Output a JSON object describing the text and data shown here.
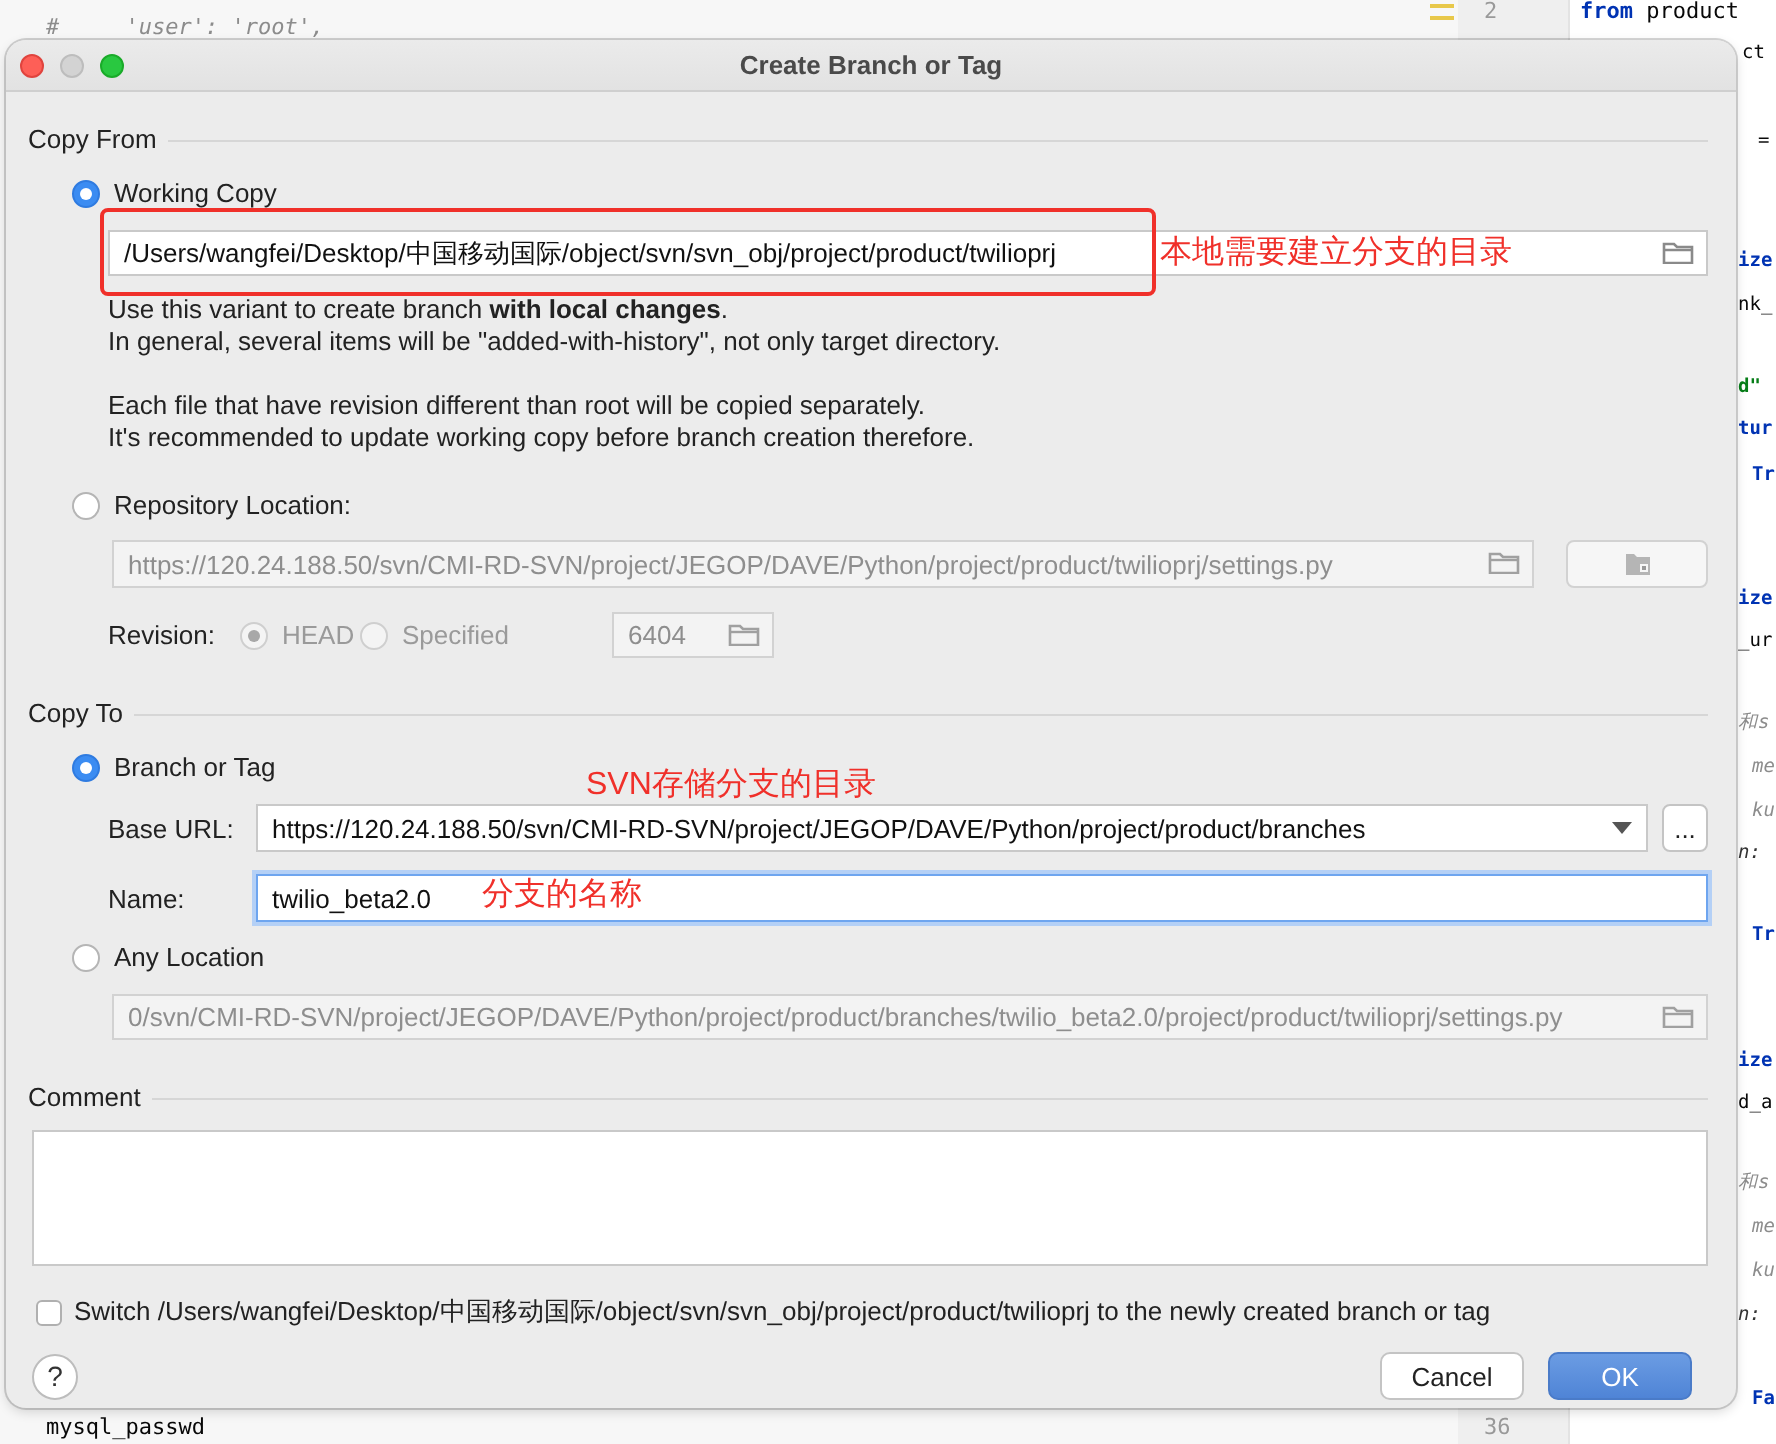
{
  "editor": {
    "left_lines": [
      {
        "text": "#     'user': 'root',",
        "kind": "comment"
      },
      {
        "text": "mysql_passwd",
        "kind": "plain"
      }
    ],
    "line_numbers": [
      "2",
      "36"
    ],
    "right_lines": [
      [
        {
          "text": "from",
          "kind": "keyword"
        },
        {
          "text": " product",
          "kind": "plain"
        }
      ],
      [
        {
          "text": "ct",
          "kind": "plain"
        }
      ],
      [
        {
          "text": "=",
          "kind": "plain"
        }
      ],
      [
        {
          "text": "ize",
          "kind": "keyword"
        }
      ],
      [
        {
          "text": "nk_",
          "kind": "plain"
        }
      ],
      [
        {
          "text": "d\"",
          "kind": "string"
        }
      ],
      [
        {
          "text": "tur",
          "kind": "keyword"
        }
      ],
      [
        {
          "text": "Tr",
          "kind": "keyword"
        }
      ],
      [
        {
          "text": "ize",
          "kind": "keyword"
        }
      ],
      [
        {
          "text": "_ur",
          "kind": "plain"
        }
      ],
      [
        {
          "text": "和s",
          "kind": "comment"
        }
      ],
      [
        {
          "text": "me",
          "kind": "comment"
        }
      ],
      [
        {
          "text": "ku",
          "kind": "comment"
        }
      ],
      [
        {
          "text": "n:",
          "kind": "param"
        }
      ],
      [
        {
          "text": "Tr",
          "kind": "keyword"
        }
      ],
      [
        {
          "text": "ize",
          "kind": "keyword"
        }
      ],
      [
        {
          "text": "d_a",
          "kind": "plain"
        }
      ],
      [
        {
          "text": "和s",
          "kind": "comment"
        }
      ],
      [
        {
          "text": "me",
          "kind": "comment"
        }
      ],
      [
        {
          "text": "ku",
          "kind": "comment"
        }
      ],
      [
        {
          "text": "n:",
          "kind": "param"
        }
      ],
      [
        {
          "text": "Fa",
          "kind": "keyword"
        }
      ]
    ]
  },
  "dialog": {
    "title": "Create Branch or Tag",
    "copy_from": {
      "heading": "Copy From",
      "working_copy": {
        "label": "Working Copy",
        "selected": true
      },
      "path_field": {
        "value": "/Users/wangfei/Desktop/中国移动国际/object/svn/svn_obj/project/product/twilioprj",
        "disabled": false
      },
      "description": [
        [
          "Use this variant to create branch **with local changes**.",
          "In general, several items will be \"added-with-history\", not only target directory."
        ],
        [
          "Each file that have revision different than root will be copied separately.",
          "It's recommended to update working copy before branch creation therefore."
        ]
      ],
      "repository_location": {
        "label": "Repository Location:",
        "selected": false
      },
      "url_field": {
        "value": "https://120.24.188.50/svn/CMI-RD-SVN/project/JEGOP/DAVE/Python/project/product/twilioprj/settings.py",
        "disabled": true
      },
      "revision": {
        "label": "Revision:",
        "options": [
          {
            "label": "HEAD",
            "selected": true,
            "disabled": true
          },
          {
            "label": "Specified",
            "selected": false,
            "disabled": true
          }
        ],
        "field": {
          "value": "6404",
          "disabled": true
        }
      }
    },
    "copy_to": {
      "heading": "Copy To",
      "branch_or_tag": {
        "label": "Branch or Tag",
        "selected": true
      },
      "base_url": {
        "label": "Base URL:",
        "value": "https://120.24.188.50/svn/CMI-RD-SVN/project/JEGOP/DAVE/Python/project/product/branches",
        "disabled": false
      },
      "more_button": "...",
      "name": {
        "label": "Name:",
        "value": "twilio_beta2.0",
        "focused": true,
        "disabled": false
      },
      "any_location": {
        "label": "Any Location",
        "selected": false
      },
      "location_field": {
        "value": "0/svn/CMI-RD-SVN/project/JEGOP/DAVE/Python/project/product/branches/twilio_beta2.0/project/product/twilioprj/settings.py",
        "disabled": true
      }
    },
    "comment": {
      "heading": "Comment"
    },
    "switch_checkbox": {
      "label": "Switch /Users/wangfei/Desktop/中国移动国际/object/svn/svn_obj/project/product/twilioprj to the newly created branch or tag",
      "checked": false
    },
    "help_button": "?",
    "buttons": [
      {
        "label": "Cancel",
        "kind": "secondary"
      },
      {
        "label": "OK",
        "kind": "default"
      }
    ]
  },
  "annotations": [
    {
      "kind": "box"
    },
    {
      "kind": "text",
      "text": "本地需要建立分支的目录"
    },
    {
      "kind": "text",
      "text": "SVN存储分支的目录"
    },
    {
      "kind": "text",
      "text": "分支的名称"
    }
  ]
}
